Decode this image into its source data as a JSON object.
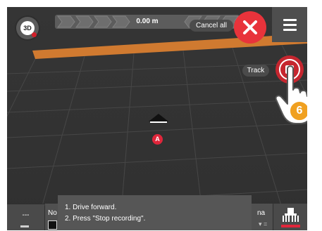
{
  "toolbar": {
    "view_toggle_label": "3D",
    "distance": "0.00 m",
    "cancel_all_label": "Cancel all"
  },
  "map": {
    "point_a_label": "A"
  },
  "track": {
    "label": "Track",
    "step_number": "6"
  },
  "bottom": {
    "left_value": "---",
    "panel_label_partial": "No",
    "panel_right_partial": "na",
    "panel_right_sub": "▾ ="
  },
  "instructions": {
    "line1": "1. Drive forward.",
    "line2": "2. Press \"Stop recording\"."
  },
  "colors": {
    "accent_red": "#e8333b",
    "field_orange": "#d07a30",
    "badge_orange": "#f0a020",
    "background": "#3a3a3a"
  }
}
